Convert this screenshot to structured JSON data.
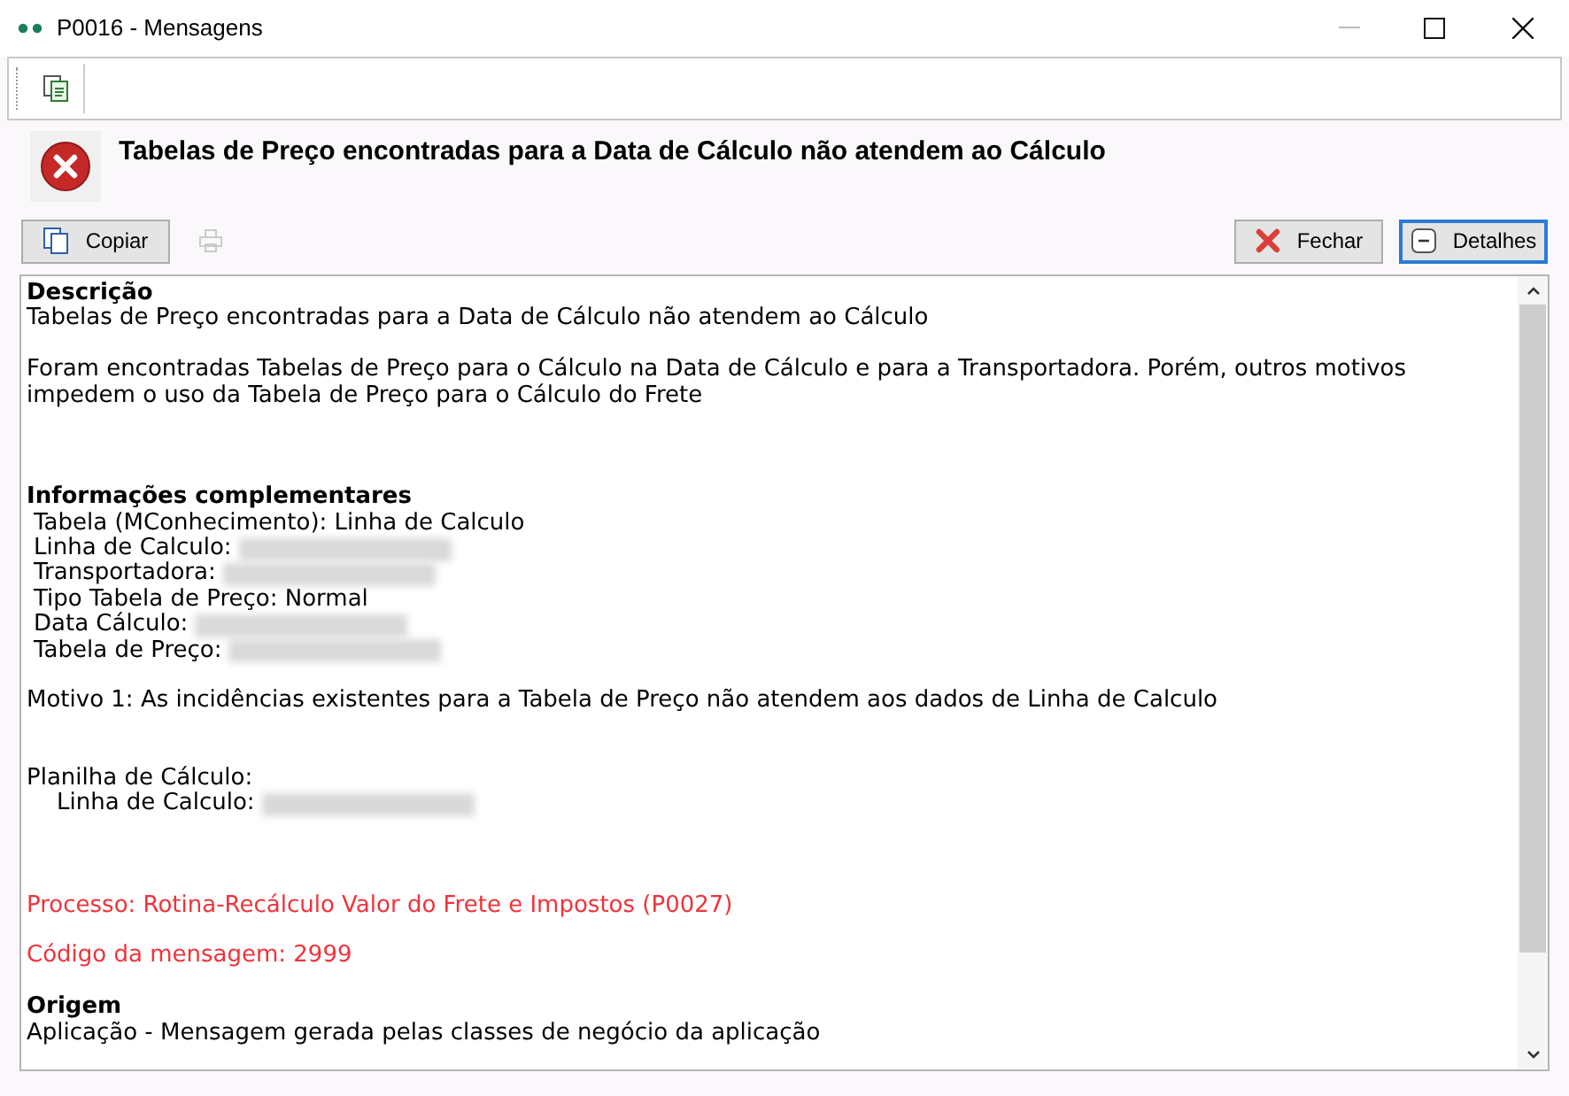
{
  "window": {
    "title": "P0016 - Mensagens"
  },
  "message": {
    "title": "Tabelas de Preço encontradas para a Data de Cálculo não atendem ao Cálculo"
  },
  "buttons": [
    {
      "kind": "copy",
      "label": "Copiar",
      "focused": false
    },
    {
      "kind": "close",
      "label": "Fechar",
      "focused": false
    },
    {
      "kind": "details",
      "label": "Detalhes",
      "focused": true
    }
  ],
  "details": [
    {
      "kind": "heading",
      "text": "Descrição"
    },
    {
      "kind": "text",
      "text": "Tabelas de Preço encontradas para a Data de Cálculo não atendem ao Cálculo"
    },
    {
      "kind": "blank"
    },
    {
      "kind": "text",
      "text": "Foram encontradas Tabelas de Preço para o Cálculo na Data de Cálculo e para a Transportadora. Porém, outros motivos impedem o uso da Tabela de Preço para o Cálculo do Frete"
    },
    {
      "kind": "blank"
    },
    {
      "kind": "blank"
    },
    {
      "kind": "blank"
    },
    {
      "kind": "heading",
      "text": "Informações complementares"
    },
    {
      "kind": "field",
      "text": "Tabela (MConhecimento): Linha de Calculo"
    },
    {
      "kind": "field",
      "text": "Linha de Calculo:",
      "redacted": true
    },
    {
      "kind": "field",
      "text": "Transportadora:",
      "redacted": true
    },
    {
      "kind": "field",
      "text": "Tipo Tabela de Preço: Normal"
    },
    {
      "kind": "field",
      "text": "Data Cálculo:",
      "redacted": true
    },
    {
      "kind": "field",
      "text": "Tabela de Preço:",
      "redacted": true
    },
    {
      "kind": "blank"
    },
    {
      "kind": "text",
      "text": "Motivo 1: As incidências existentes para a Tabela de Preço não atendem aos dados de Linha de Calculo"
    },
    {
      "kind": "blank"
    },
    {
      "kind": "blank"
    },
    {
      "kind": "text",
      "text": "Planilha de Cálculo:"
    },
    {
      "kind": "subfield",
      "text": "Linha de Calculo:",
      "redacted": true
    },
    {
      "kind": "blank"
    },
    {
      "kind": "blank"
    },
    {
      "kind": "blank"
    },
    {
      "kind": "alert",
      "text": "Processo: Rotina-Recálculo Valor do Frete e Impostos (P0027)"
    },
    {
      "kind": "blank"
    },
    {
      "kind": "alert",
      "text": "Código da mensagem: 2999"
    },
    {
      "kind": "blank"
    },
    {
      "kind": "heading",
      "text": "Origem"
    },
    {
      "kind": "text",
      "text": "Aplicação - Mensagem gerada pelas classes de negócio da aplicação"
    }
  ]
}
